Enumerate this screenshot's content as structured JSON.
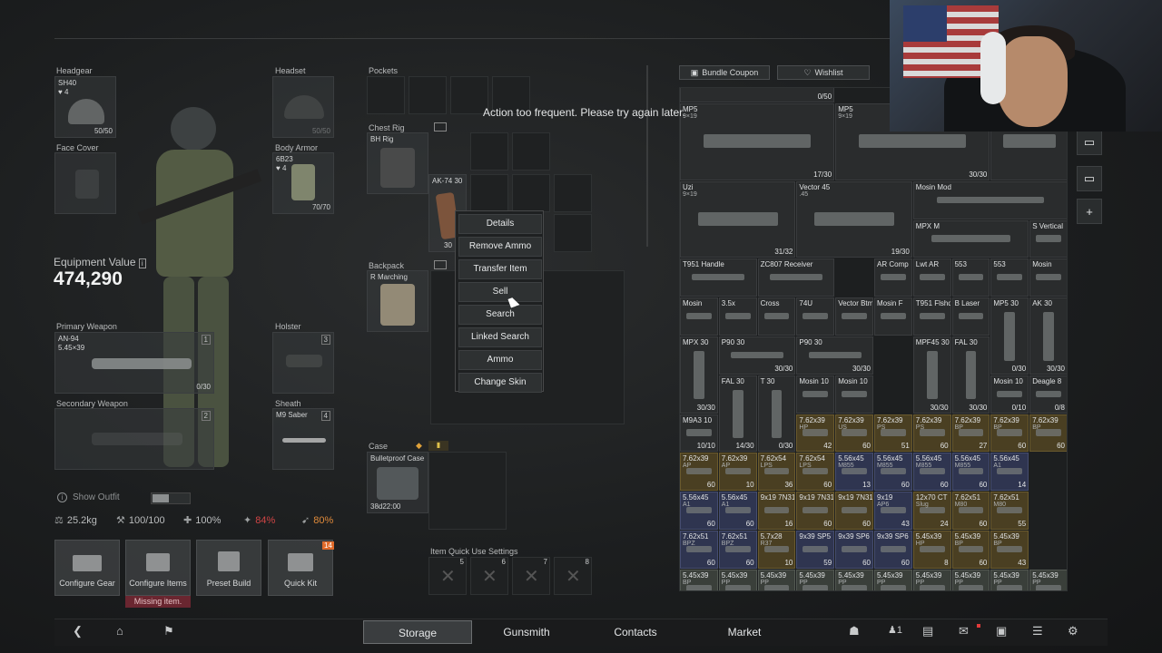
{
  "toast": "Action too frequent. Please try again later.",
  "gear": {
    "headgear": {
      "label": "Headgear",
      "item": "SH40",
      "level": "4",
      "durability": "50/50"
    },
    "headset": {
      "label": "Headset",
      "durability": "50/50"
    },
    "face_cover": {
      "label": "Face Cover"
    },
    "body_armor": {
      "label": "Body Armor",
      "item": "6B23",
      "level": "4",
      "durability": "70/70"
    },
    "primary": {
      "label": "Primary Weapon",
      "item": "AN-94",
      "caliber": "5.45×39",
      "slot": "1",
      "ammo": "0/30"
    },
    "secondary": {
      "label": "Secondary Weapon",
      "slot": "2"
    },
    "holster": {
      "label": "Holster",
      "slot": "3"
    },
    "sheath": {
      "label": "Sheath",
      "item": "M9 Saber",
      "slot": "4"
    }
  },
  "equipment": {
    "label": "Equipment Value",
    "value": "474,290"
  },
  "show_outfit": "Show Outfit",
  "stats": {
    "weight": "25.2kg",
    "durability": "100/100",
    "health": "100%",
    "armor_pct": "84%",
    "speed_pct": "80%"
  },
  "buttons": {
    "configure_gear": "Configure Gear",
    "configure_items": "Configure Items",
    "preset_build": "Preset Build",
    "quick_kit": "Quick Kit",
    "quick_kit_badge": "14",
    "missing_item": "Missing item."
  },
  "containers": {
    "pockets": "Pockets",
    "chest_rig": "Chest Rig",
    "chest_rig_item": "BH Rig",
    "backpack": "Backpack",
    "backpack_item": "R Marching",
    "case": "Case",
    "case_item": "Bulletproof Case",
    "case_timer": "38d22:00",
    "quick_use": "Item Quick Use Settings",
    "quick_slots": [
      "5",
      "6",
      "7",
      "8"
    ],
    "rig_item": {
      "name": "AK-74 30",
      "qty": "30"
    }
  },
  "context_menu": [
    "Details",
    "Remove Ammo",
    "Transfer Item",
    "Sell",
    "Search",
    "Linked Search",
    "Ammo",
    "Change Skin"
  ],
  "stash_top": {
    "bundle": "Bundle Coupon",
    "wishlist": "Wishlist",
    "first_qty": "0/50"
  },
  "stash_items": [
    {
      "n": "MP5",
      "c": "9×19",
      "q": "17/30",
      "t": "w"
    },
    {
      "n": "MP5",
      "c": "9×19",
      "q": "30/30",
      "t": "w"
    },
    {
      "n": "M24 Cov",
      "c": "",
      "q": "",
      "t": "w"
    },
    {
      "n": "Uzi",
      "c": "9×19",
      "q": "31/32",
      "t": "w"
    },
    {
      "n": "Vector 45",
      "c": ".45",
      "q": "19/30",
      "t": "w"
    },
    {
      "n": "Mosin Mod",
      "c": "",
      "q": "",
      "t": "w"
    },
    {
      "n": "MPX M",
      "c": "",
      "q": "",
      "t": "w"
    },
    {
      "n": "S Vertical",
      "c": "",
      "q": "",
      "t": "w"
    },
    {
      "n": "T951 Handle",
      "c": "",
      "q": "",
      "t": "w"
    },
    {
      "n": "ZC807 Receiver",
      "c": "",
      "q": "",
      "t": "w"
    },
    {
      "n": "AR Comp",
      "c": "",
      "q": "",
      "t": "w"
    },
    {
      "n": "Lwt AR",
      "c": "",
      "q": "",
      "t": "w"
    },
    {
      "n": "553",
      "c": "",
      "q": "",
      "t": "w"
    },
    {
      "n": "553",
      "c": "",
      "q": "",
      "t": "w"
    },
    {
      "n": "Mosin",
      "c": "",
      "q": "",
      "t": "w"
    },
    {
      "n": "Mosin",
      "c": "",
      "q": "",
      "t": "w"
    },
    {
      "n": "3.5x",
      "c": "",
      "q": "",
      "t": "w"
    },
    {
      "n": "Cross",
      "c": "",
      "q": "",
      "t": "w"
    },
    {
      "n": "74U",
      "c": "",
      "q": "",
      "t": "w"
    },
    {
      "n": "Vector Btm",
      "c": "",
      "q": "",
      "t": "w"
    },
    {
      "n": "Mosin F",
      "c": "",
      "q": "",
      "t": "w"
    },
    {
      "n": "T951 Flshd",
      "c": "",
      "q": "",
      "t": "w"
    },
    {
      "n": "B Laser",
      "c": "",
      "q": "",
      "t": "w"
    },
    {
      "n": "MP5 30",
      "c": "",
      "q": "0/30",
      "t": "w"
    },
    {
      "n": "AK 30",
      "c": "",
      "q": "30/30",
      "t": "w"
    },
    {
      "n": "MPX 30",
      "c": "",
      "q": "30/30",
      "t": "w"
    },
    {
      "n": "P90 30",
      "c": "",
      "q": "30/30",
      "t": "w"
    },
    {
      "n": "P90 30",
      "c": "",
      "q": "30/30",
      "t": "w"
    },
    {
      "n": "MPF45 30",
      "c": "",
      "q": "30/30",
      "t": "w"
    },
    {
      "n": "FAL 30",
      "c": "",
      "q": "30/30",
      "t": "w"
    },
    {
      "n": "FAL 30",
      "c": "",
      "q": "14/30",
      "t": "w"
    },
    {
      "n": "T 30",
      "c": "",
      "q": "0/30",
      "t": "w"
    },
    {
      "n": "Mosin 10",
      "c": "",
      "q": "",
      "t": "w"
    },
    {
      "n": "Mosin 10",
      "c": "",
      "q": "",
      "t": "w"
    },
    {
      "n": "Mosin 10",
      "c": "",
      "q": "0/10",
      "t": "w"
    },
    {
      "n": "Deagle 8",
      "c": "",
      "q": "0/8",
      "t": "w"
    },
    {
      "n": "M9A3 10",
      "c": "",
      "q": "10/10",
      "t": "w"
    }
  ],
  "ammo_rows": [
    [
      [
        "7.62x39",
        "HP",
        "42",
        "y"
      ],
      [
        "7.62x39",
        "US",
        "60",
        "y"
      ],
      [
        "7.62x39",
        "PS",
        "51",
        "y"
      ],
      [
        "7.62x39",
        "PS",
        "60",
        "y"
      ],
      [
        "7.62x39",
        "BP",
        "27",
        "y"
      ],
      [
        "7.62x39",
        "BP",
        "60",
        "y"
      ],
      [
        "7.62x39",
        "BP",
        "60",
        "y"
      ]
    ],
    [
      [
        "7.62x39",
        "AP",
        "60",
        "y"
      ],
      [
        "7.62x39",
        "AP",
        "10",
        "y"
      ],
      [
        "7.62x54",
        "LPS",
        "36",
        "y"
      ],
      [
        "7.62x54",
        "LPS",
        "60",
        "y"
      ],
      [
        "5.56x45",
        "M855",
        "13",
        "b"
      ],
      [
        "5.56x45",
        "M855",
        "60",
        "b"
      ],
      [
        "5.56x45",
        "M855",
        "60",
        "b"
      ],
      [
        "5.56x45",
        "M855",
        "60",
        "b"
      ],
      [
        "5.56x45",
        "A1",
        "14",
        "b"
      ]
    ],
    [
      [
        "5.56x45",
        "A1",
        "60",
        "b"
      ],
      [
        "5.56x45",
        "A1",
        "60",
        "b"
      ],
      [
        "9x19 7N31",
        "",
        "16",
        "y"
      ],
      [
        "9x19 7N31",
        "",
        "60",
        "y"
      ],
      [
        "9x19 7N31",
        "",
        "60",
        "y"
      ],
      [
        "9x19",
        "AP6",
        "43",
        "b"
      ],
      [
        "12x70 CT",
        "Slug",
        "24",
        "y"
      ],
      [
        "7.62x51",
        "M80",
        "60",
        "y"
      ],
      [
        "7.62x51",
        "M80",
        "55",
        "y"
      ]
    ],
    [
      [
        "7.62x51",
        "BPZ",
        "60",
        "b"
      ],
      [
        "7.62x51",
        "BPZ",
        "60",
        "b"
      ],
      [
        "5.7x28",
        "R37",
        "10",
        "y"
      ],
      [
        "9x39 SP5",
        "",
        "59",
        "b"
      ],
      [
        "9x39 SP6",
        "",
        "60",
        "b"
      ],
      [
        "9x39 SP6",
        "",
        "60",
        "b"
      ],
      [
        "5.45x39",
        "HP",
        "8",
        "y"
      ],
      [
        "5.45x39",
        "BP",
        "60",
        "y"
      ],
      [
        "5.45x39",
        "BP",
        "43",
        "y"
      ]
    ],
    [
      [
        "5.45x39",
        "BP",
        "",
        ""
      ],
      [
        "5.45x39",
        "PP",
        "",
        ""
      ],
      [
        "5.45x39",
        "PP",
        "",
        ""
      ],
      [
        "5.45x39",
        "PP",
        "",
        ""
      ],
      [
        "5.45x39",
        "PP",
        "",
        ""
      ],
      [
        "5.45x39",
        "PP",
        "",
        ""
      ],
      [
        "5.45x39",
        "PP",
        "",
        ""
      ],
      [
        "5.45x39",
        "PP",
        "",
        ""
      ],
      [
        "5.45x39",
        "PP",
        "",
        ""
      ],
      [
        "5.45x39",
        "PP",
        "",
        ""
      ]
    ]
  ],
  "nav": {
    "storage": "Storage",
    "gunsmith": "Gunsmith",
    "contacts": "Contacts",
    "market": "Market",
    "friends_count": "1"
  },
  "colors": {
    "accent_orange": "#e06a2a",
    "armor_red": "#d04545",
    "speed_orange": "#e08a3a"
  }
}
